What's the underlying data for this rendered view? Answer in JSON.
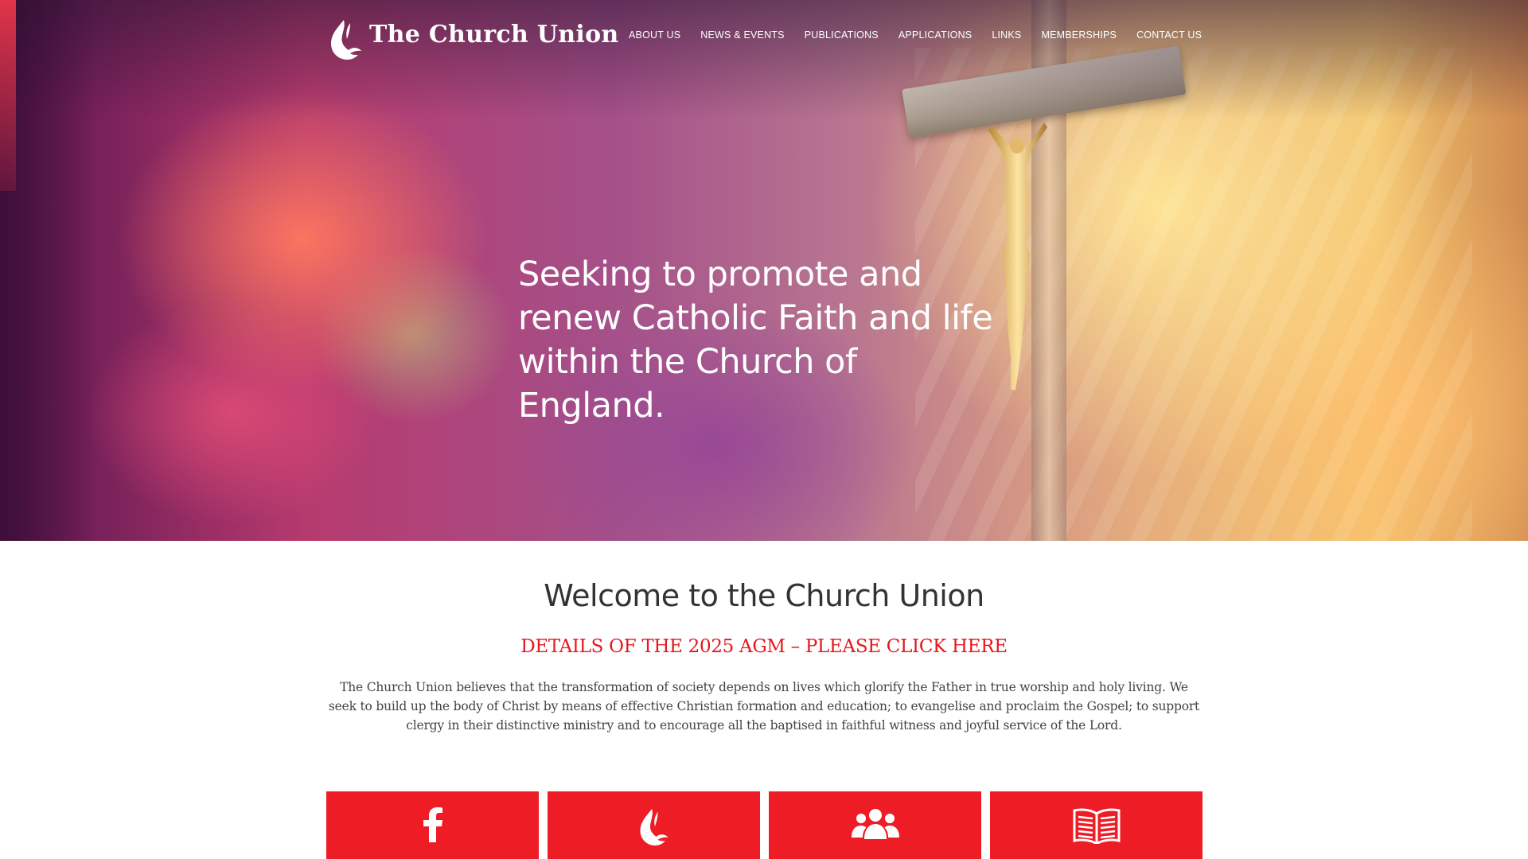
{
  "site": {
    "logo_text": "The Church Union"
  },
  "nav": {
    "items": [
      {
        "label": "ABOUT US"
      },
      {
        "label": "NEWS & EVENTS"
      },
      {
        "label": "PUBLICATIONS"
      },
      {
        "label": "APPLICATIONS"
      },
      {
        "label": "LINKS"
      },
      {
        "label": "MEMBERSHIPS"
      },
      {
        "label": "CONTACT US"
      }
    ]
  },
  "hero": {
    "headline_line1": "Seeking to promote and",
    "headline_line2": "renew Catholic Faith and life",
    "headline_line3": "within the Church of England."
  },
  "main": {
    "title": "Welcome to the Church Union",
    "agm_link": "DETAILS OF THE 2025 AGM – PLEASE CLICK HERE",
    "intro": "The Church Union believes that the transformation of society depends on lives which glorify the Father in true worship and holy living. We seek to build up the body of Christ by means of effective Christian formation and education; to evangelise and proclaim the Gospel; to support clergy in their distinctive ministry and to encourage all the baptised in faithful witness and joyful service of the Lord."
  },
  "tiles": [
    {
      "icon": "facebook-icon"
    },
    {
      "icon": "church-union-dove-icon"
    },
    {
      "icon": "group-icon"
    },
    {
      "icon": "open-book-icon"
    }
  ],
  "colors": {
    "accent_red": "#ee1d25",
    "link_red": "#e6171d",
    "heading_text": "#333333",
    "body_text": "#444444",
    "nav_text": "#ffffff"
  }
}
